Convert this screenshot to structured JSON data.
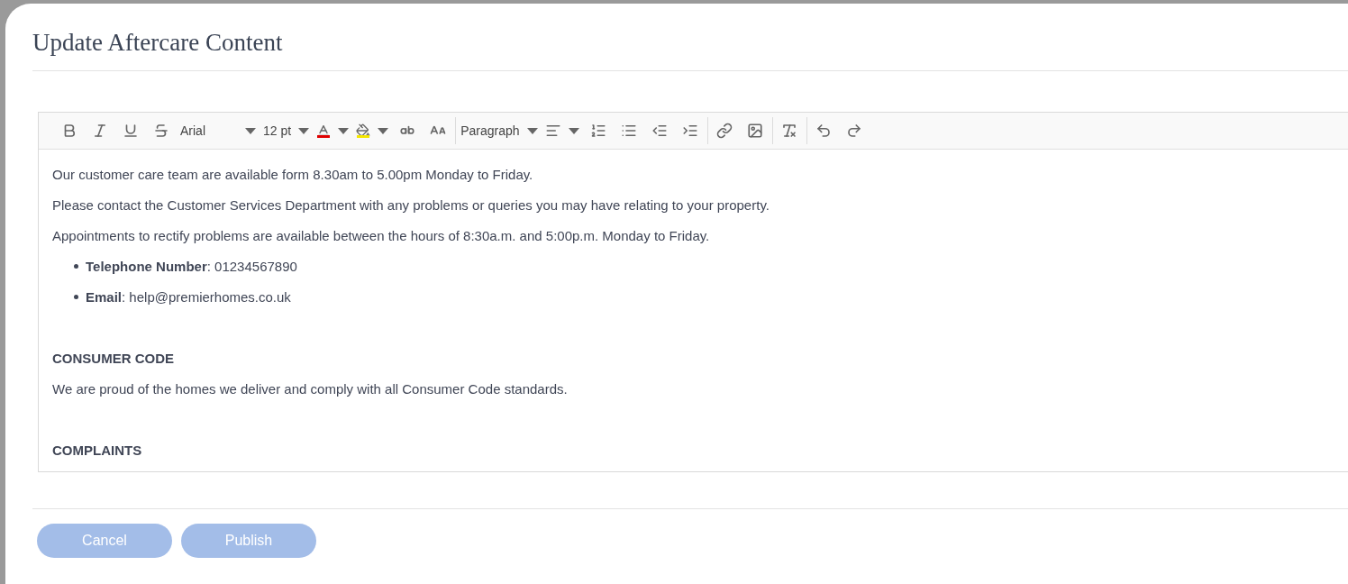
{
  "dialog": {
    "title": "Update Aftercare Content"
  },
  "toolbar": {
    "groups": [
      [
        {
          "kind": "button"
        },
        {
          "kind": "button"
        },
        {
          "kind": "button"
        },
        {
          "kind": "button"
        },
        {
          "kind": "dropdown",
          "label": "Arial"
        },
        {
          "kind": "dropdown",
          "label": "12 pt"
        },
        {
          "kind": "color_dropdown",
          "color": "#e00000"
        },
        {
          "kind": "color_dropdown",
          "color": "#f5e600"
        },
        {
          "kind": "button"
        },
        {
          "kind": "button"
        }
      ],
      [
        {
          "kind": "dropdown",
          "label": "Paragraph"
        },
        {
          "kind": "icon_dropdown"
        },
        {
          "kind": "button"
        },
        {
          "kind": "button"
        },
        {
          "kind": "button"
        },
        {
          "kind": "button"
        }
      ],
      [
        {
          "kind": "button"
        },
        {
          "kind": "button"
        }
      ],
      [
        {
          "kind": "button"
        }
      ],
      [
        {
          "kind": "button"
        },
        {
          "kind": "button"
        }
      ]
    ]
  },
  "content": [
    {
      "kind": "paragraph",
      "text": "Our customer care team are available form 8.30am to 5.00pm Monday to Friday."
    },
    {
      "kind": "paragraph",
      "text": "Please contact the Customer Services Department with any problems or queries you may have relating to your property."
    },
    {
      "kind": "paragraph",
      "text": "Appointments to rectify problems are available between the hours of 8:30a.m. and 5:00p.m. Monday to Friday."
    },
    {
      "kind": "list",
      "items": [
        "**Telephone Number**: 01234567890",
        "**Email**: help@premierhomes.co.uk"
      ]
    },
    {
      "kind": "heading",
      "text": "CONSUMER CODE"
    },
    {
      "kind": "paragraph",
      "text": "We are proud of the homes we deliver and comply with all Consumer Code standards."
    },
    {
      "kind": "heading",
      "text": "COMPLAINTS"
    }
  ],
  "buttons": [
    {
      "label": "Cancel",
      "disabled": true
    },
    {
      "label": "Publish",
      "disabled": true
    }
  ]
}
